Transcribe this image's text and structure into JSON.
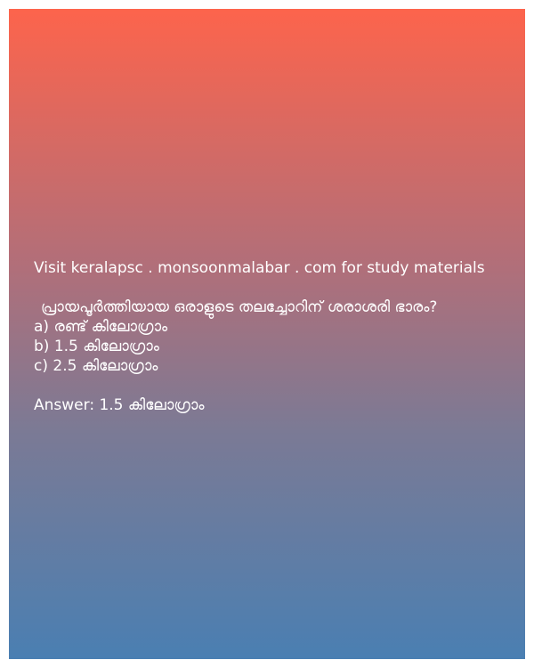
{
  "promo_text": "Visit keralapsc . monsoonmalabar . com for study materials",
  "question": "പ്രായപൂർത്തിയായ ഒരാളുടെ തലച്ചോറിന് ശരാശരി ഭാരം?",
  "options": [
    "a) രണ്ട് കിലോഗ്രാം",
    "b) 1.5 കിലോഗ്രാം",
    "c) 2.5 കിലോഗ്രാം"
  ],
  "answer": "Answer: 1.5 കിലോഗ്രാം",
  "colors": {
    "gradient_top": "#fd644c",
    "gradient_bottom": "#4a7fb2",
    "text": "#ffffff"
  }
}
